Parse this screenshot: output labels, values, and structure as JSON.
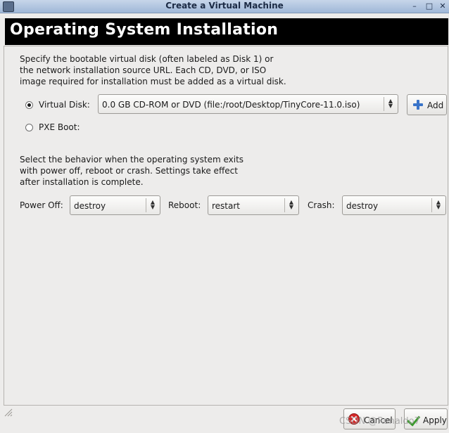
{
  "window": {
    "title": "Create a Virtual Machine",
    "minimize": "–",
    "maximize": "□",
    "close": "✕"
  },
  "header": {
    "title": "Operating System Installation"
  },
  "intro": {
    "lines": [
      "Specify the bootable virtual disk (often labeled as Disk 1) or",
      "the network installation source URL.  Each CD, DVD, or ISO",
      "image required for installation must be added as a virtual disk."
    ]
  },
  "install_source": {
    "virtual_disk_label": "Virtual Disk:",
    "virtual_disk_selected": true,
    "virtual_disk_value": "0.0 GB CD-ROM or DVD (file:/root/Desktop/TinyCore-11.0.iso)",
    "add_label": "Add",
    "pxe_label": "PXE Boot:",
    "pxe_selected": false
  },
  "behavior": {
    "lines": [
      "Select the behavior when the operating system exits",
      "with power off, reboot or crash.  Settings take effect",
      "after installation is complete."
    ],
    "power_off_label": "Power Off:",
    "power_off_value": "destroy",
    "reboot_label": "Reboot:",
    "reboot_value": "restart",
    "crash_label": "Crash:",
    "crash_value": "destroy"
  },
  "footer": {
    "cancel_label": "Cancel",
    "apply_label": "Apply"
  },
  "icons": {
    "app": "vm-app-icon",
    "add": "plus-icon",
    "cancel": "cancel-icon",
    "apply": "check-icon",
    "combo": "up-down-arrows-icon"
  },
  "colors": {
    "header_bg": "#000000",
    "header_text": "#ffffff",
    "window_bg": "#edeceb",
    "titlebar": "#b5c7e0"
  },
  "watermark": "CSDN @Ronaldo7"
}
